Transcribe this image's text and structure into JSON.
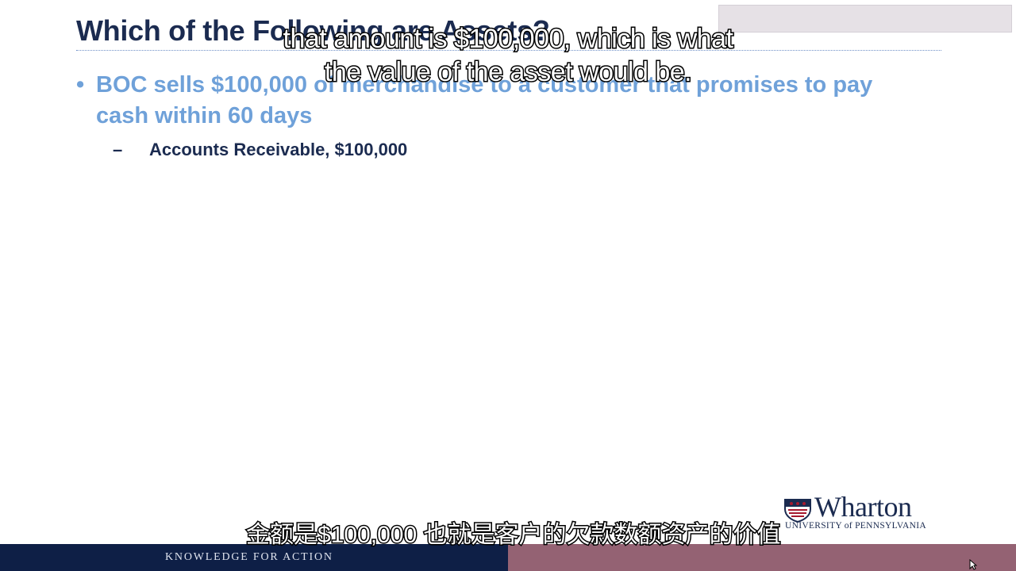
{
  "slide": {
    "title": "Which of the Following are Assets?",
    "bullet_marker": "•",
    "bullet_text": "BOC sells $100,000 of merchandise to a customer that promises to pay cash within 60 days",
    "sub_marker": "–",
    "sub_text": "Accounts Receivable, $100,000"
  },
  "subtitles": {
    "english": "that amount is $100,000, which is what the value of the asset would be.",
    "chinese": "金额是$100,000 也就是客户的欠款数额资产的价值"
  },
  "logo": {
    "name": "Wharton",
    "university": "UNIVERSITY of PENNSYLVANIA"
  },
  "footer": {
    "tagline": "KNOWLEDGE FOR ACTION"
  },
  "colors": {
    "title": "#1b2b50",
    "bullet": "#6fa1d9",
    "footer_navy": "#0e1f46",
    "footer_mauve": "#946273"
  }
}
